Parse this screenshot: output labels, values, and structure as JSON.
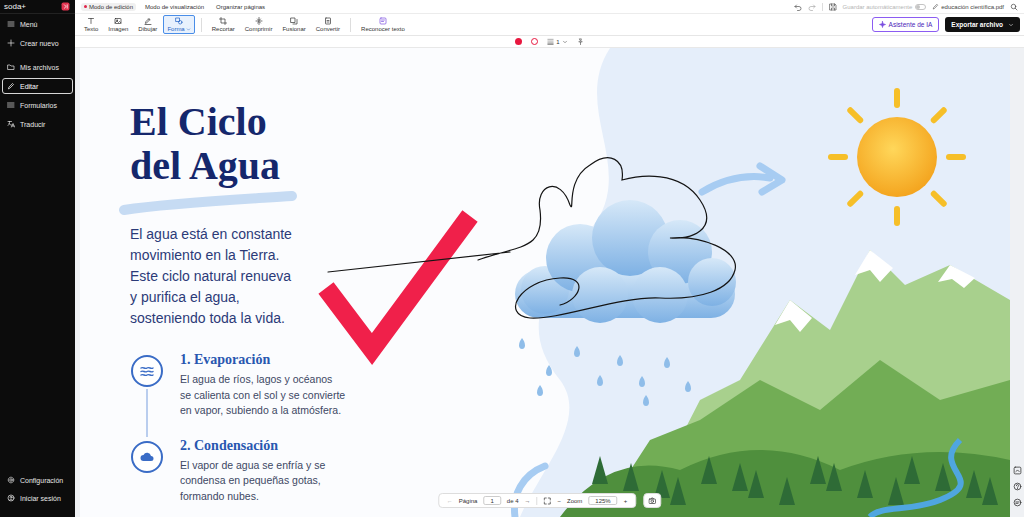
{
  "app": {
    "logo": "soda+"
  },
  "sidebar": {
    "sections": [
      {
        "items": [
          {
            "label": "Menú",
            "selected": false
          },
          {
            "label": "Crear nuevo",
            "selected": false
          }
        ]
      },
      {
        "items": [
          {
            "label": "Mis archivos",
            "selected": false
          },
          {
            "label": "Editar",
            "selected": true
          },
          {
            "label": "Formularios",
            "selected": false
          },
          {
            "label": "Traducir",
            "selected": false
          }
        ]
      }
    ],
    "footer": [
      {
        "label": "Configuración"
      },
      {
        "label": "Iniciar sesión"
      }
    ]
  },
  "topbar": {
    "modes": [
      {
        "label": "Modo de edición",
        "selected": true
      },
      {
        "label": "Modo de visualización",
        "selected": false
      },
      {
        "label": "Organizar páginas",
        "selected": false
      }
    ],
    "autosave": {
      "label": "Guardar automáticamente",
      "on": false
    },
    "filename": "educación científica.pdf"
  },
  "toolbar": {
    "tools": [
      {
        "label": "Texto",
        "selected": false,
        "has_menu": false
      },
      {
        "label": "Imagen",
        "selected": false,
        "has_menu": false
      },
      {
        "label": "Dibujar",
        "selected": false,
        "has_menu": false
      },
      {
        "label": "Forma",
        "selected": true,
        "has_menu": true
      },
      {
        "label": "Recortar",
        "selected": false,
        "has_menu": false
      },
      {
        "label": "Comprimir",
        "selected": false,
        "has_menu": false
      },
      {
        "label": "Fusionar",
        "selected": false,
        "has_menu": false
      },
      {
        "label": "Convertir",
        "selected": false,
        "has_menu": false
      },
      {
        "label": "Reconocer texto",
        "selected": false,
        "has_menu": false
      }
    ],
    "ai_button": "Asistente de IA",
    "export_button": "Exportar archivo"
  },
  "shape_options": {
    "swatches": [
      {
        "kind": "fill",
        "color": "#e8173f"
      },
      {
        "kind": "stroke",
        "color": "#e8173f"
      }
    ],
    "stroke_width": "1"
  },
  "document": {
    "title_lines": [
      "El Ciclo",
      "del Agua"
    ],
    "intro_lines": [
      "El agua está en constante",
      "movimiento en la Tierra.",
      "Este ciclo natural renueva",
      "y purifica el agua,",
      "sosteniendo toda la vida."
    ],
    "steps": [
      {
        "title": "1. Evaporación",
        "lines": [
          "El agua de ríos, lagos y océanos",
          "se calienta con el sol y se convierte",
          "en vapor, subiendo a la atmósfera."
        ]
      },
      {
        "title": "2. Condensación",
        "lines": [
          "El vapor de agua se enfría y se",
          "condensa en pequeñas gotas,",
          "formando nubes."
        ]
      }
    ]
  },
  "annotations": [
    {
      "kind": "check",
      "color": "#f0204a"
    },
    {
      "kind": "ink",
      "color": "#141414"
    }
  ],
  "pager": {
    "prev": {
      "label": "←",
      "disabled": true
    },
    "page_label": "Página",
    "page": "1",
    "page_total": "de 4",
    "next": {
      "label": "→",
      "disabled": false
    },
    "zoom_out": "−",
    "zoom_label": "Zoom",
    "zoom": "125%",
    "zoom_in": "+"
  }
}
